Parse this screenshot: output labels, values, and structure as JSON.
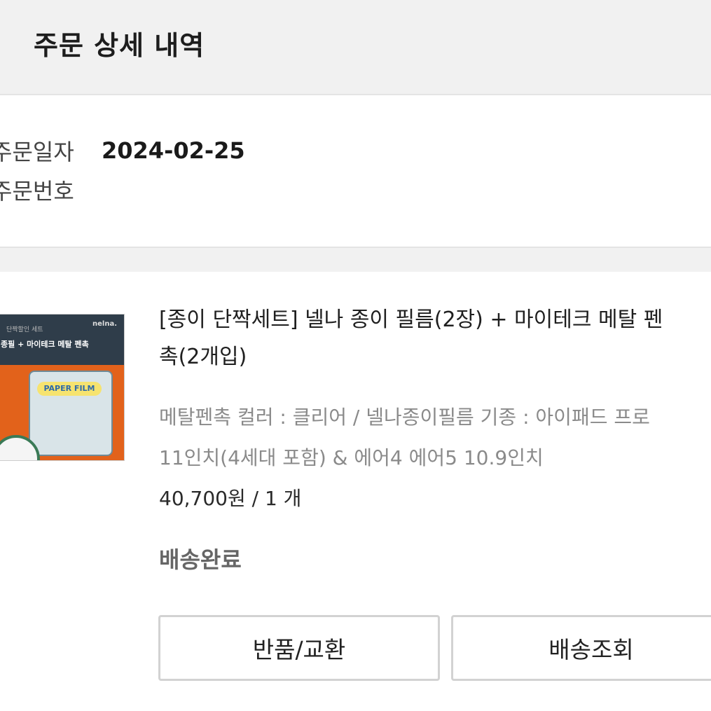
{
  "header": {
    "title": "주문 상세 내역"
  },
  "order": {
    "date_label": "주문일자",
    "date_value": "2024-02-25",
    "number_label": "주문번호",
    "number_value": ""
  },
  "item": {
    "thumbnail": {
      "brand": "nelna.",
      "top_text": "단짝할인 세트",
      "title_text": "종필 + 마이테크 메탈 펜촉",
      "film_text": "PAPER FILM"
    },
    "name_line1": "[종이 단짝세트] 넬나 종이 필름(2장) + 마이테크 메탈 펜",
    "name_line2": "촉(2개입)",
    "option_line1": "메탈펜촉 컬러 : 클리어 / 넬나종이필름 기종 : 아이패드 프로",
    "option_line2": "11인치(4세대 포함) & 에어4 에어5 10.9인치",
    "price": "40,700원 / 1 개",
    "status": "배송완료"
  },
  "buttons": {
    "return_exchange": "반품/교환",
    "track_delivery": "배송조회"
  }
}
